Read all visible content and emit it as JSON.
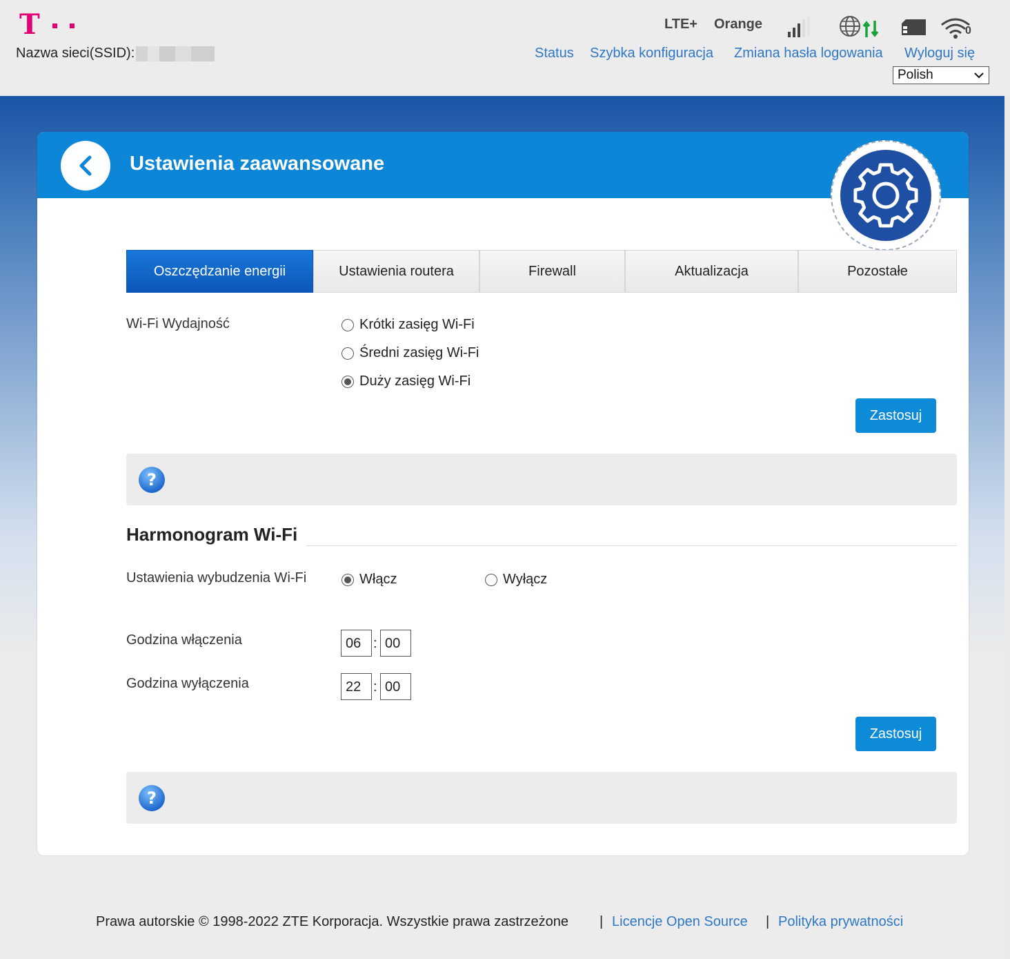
{
  "header": {
    "ssid_label": "Nazwa sieci(SSID):",
    "network_type": "LTE+",
    "operator": "Orange",
    "nav": [
      "Status",
      "Szybka konfiguracja",
      "Zmiana hasła logowania",
      "Wyloguj się"
    ],
    "language": "Polish",
    "wifi_clients": "0",
    "brand_color": "#e20074"
  },
  "card": {
    "title": "Ustawienia zaawansowane",
    "tabs": [
      "Oszczędzanie energii",
      "Ustawienia routera",
      "Firewall",
      "Aktualizacja",
      "Pozostałe"
    ],
    "active_tab": "Oszczędzanie energii"
  },
  "wifi_performance": {
    "label": "Wi-Fi Wydajność",
    "options": [
      "Krótki zasięg Wi-Fi",
      "Średni zasięg Wi-Fi",
      "Duży zasięg Wi-Fi"
    ],
    "selected": "Duży zasięg Wi-Fi",
    "apply_label": "Zastosuj"
  },
  "schedule": {
    "title": "Harmonogram Wi-Fi",
    "wake_label": "Ustawienia wybudzenia Wi-Fi",
    "on_label": "Włącz",
    "off_label": "Wyłącz",
    "selected": "Włącz",
    "start_label": "Godzina włączenia",
    "start_hour": "06",
    "start_minute": "00",
    "end_label": "Godzina wyłączenia",
    "end_hour": "22",
    "end_minute": "00",
    "colon": ":",
    "apply_label": "Zastosuj"
  },
  "footer": {
    "copyright": "Prawa autorskie © 1998-2022 ZTE Korporacja. Wszystkie prawa zastrzeżone",
    "separator": "|",
    "open_source": "Licencje Open Source",
    "privacy": "Polityka prywatności"
  }
}
